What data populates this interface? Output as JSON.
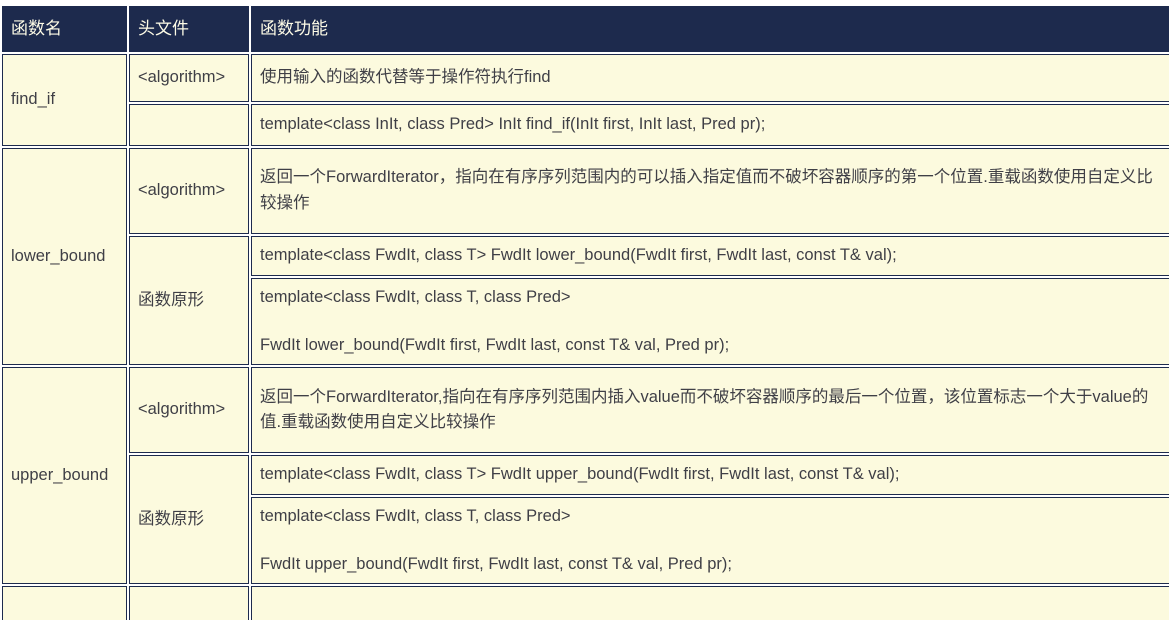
{
  "table": {
    "headers": {
      "name": "函数名",
      "header_file": "头文件",
      "function": "函数功能"
    },
    "rows": [
      {
        "name": "find_if",
        "sub": [
          {
            "header_file": "<algorithm>",
            "content": "使用输入的函数代替等于操作符执行find"
          },
          {
            "header_file": "",
            "content": "template<class InIt, class Pred> InIt find_if(InIt first, InIt last, Pred pr);"
          }
        ]
      },
      {
        "name": "lower_bound",
        "sub": [
          {
            "header_file": "<algorithm>",
            "content": "返回一个ForwardIterator，指向在有序序列范围内的可以插入指定值而不破坏容器顺序的第一个位置.重载函数使用自定义比较操作"
          },
          {
            "header_file": "函数原形",
            "content": "template<class FwdIt, class T> FwdIt lower_bound(FwdIt first, FwdIt last, const T& val);"
          },
          {
            "header_file": "",
            "content_lines": [
              "template<class FwdIt, class T, class Pred>",
              "FwdIt lower_bound(FwdIt first, FwdIt last, const T& val, Pred pr);"
            ]
          }
        ]
      },
      {
        "name": "upper_bound",
        "sub": [
          {
            "header_file": "<algorithm>",
            "content": "返回一个ForwardIterator,指向在有序序列范围内插入value而不破坏容器顺序的最后一个位置，该位置标志一个大于value的值.重载函数使用自定义比较操作"
          },
          {
            "header_file": "函数原形",
            "content": "template<class FwdIt, class T> FwdIt upper_bound(FwdIt first, FwdIt last, const T& val);"
          },
          {
            "header_file": "",
            "content_lines": [
              "template<class FwdIt, class T, class Pred>",
              "FwdIt upper_bound(FwdIt first, FwdIt last, const T& val, Pred pr);"
            ]
          }
        ]
      },
      {
        "name": "",
        "sub": [
          {
            "header_file": "",
            "content": ""
          }
        ]
      }
    ]
  },
  "colors": {
    "header_background": "#1d2a4d",
    "header_text": "#fdfbe6",
    "cell_background": "#fcfade",
    "cell_text": "#3f3f46",
    "border": "#1d2a4d",
    "page_background": "#ffffff"
  }
}
